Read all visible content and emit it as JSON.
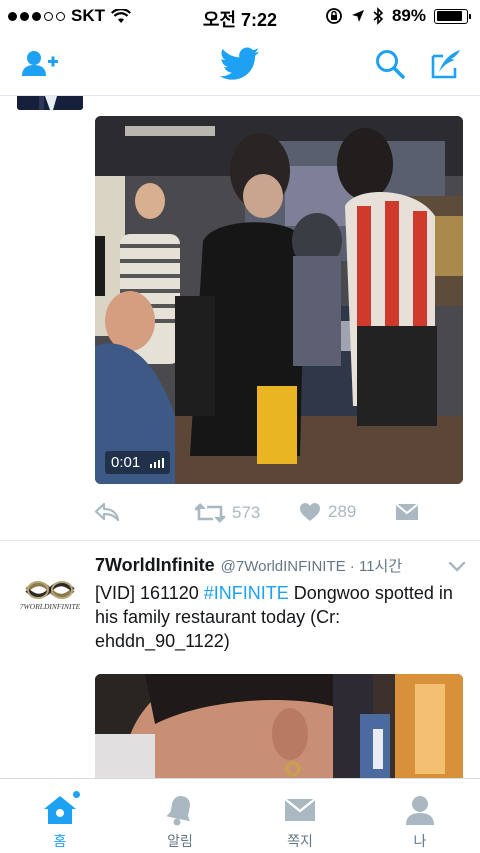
{
  "status_bar": {
    "carrier": "SKT",
    "time": "오전 7:22",
    "battery": "89%",
    "battery_level": 0.89
  },
  "nav": {
    "icons": [
      "add-user-icon",
      "twitter-bird-icon",
      "search-icon",
      "compose-icon"
    ],
    "accent": "#1da1f2"
  },
  "tweet1": {
    "video_time": "0:01",
    "retweet_count": "573",
    "like_count": "289"
  },
  "tweet2": {
    "author": "7WorldInfinite",
    "handle": "@7WorldINFINITE · 11시간",
    "text_part1": "[VID] 161120 ",
    "hashtag": "#INFINITE",
    "text_part2": " Dongwoo spotted in his family restaurant today (Cr: ehddn_90_1122)",
    "avatar_logo_text": "7WORLDINFINITE"
  },
  "tabs": [
    {
      "label": "홈",
      "icon": "home-icon",
      "active": true
    },
    {
      "label": "알림",
      "icon": "bell-icon",
      "active": false
    },
    {
      "label": "쪽지",
      "icon": "envelope-icon",
      "active": false
    },
    {
      "label": "나",
      "icon": "profile-icon",
      "active": false
    }
  ]
}
